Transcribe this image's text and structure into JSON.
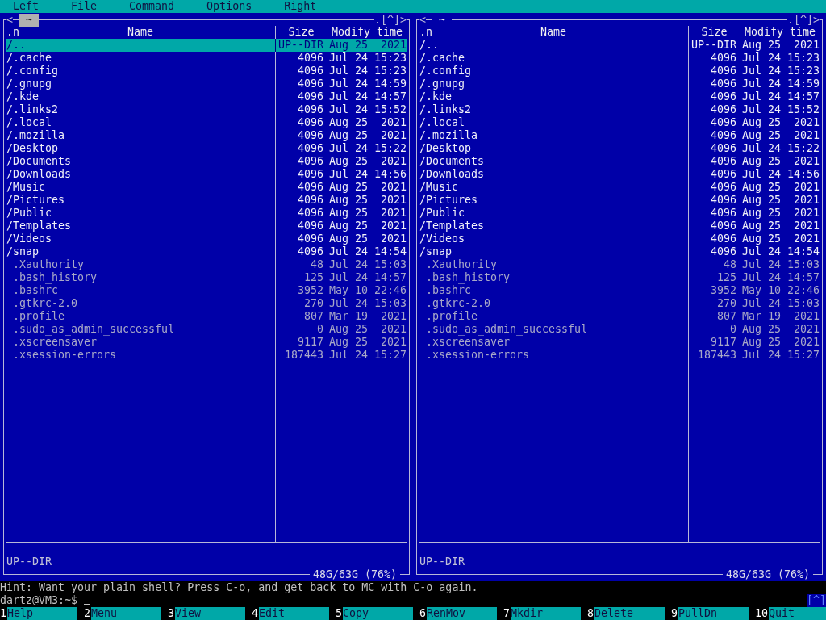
{
  "menu": [
    {
      "label": "Left"
    },
    {
      "label": "File"
    },
    {
      "label": "Command"
    },
    {
      "label": "Options"
    },
    {
      "label": "Right"
    }
  ],
  "panels": [
    {
      "active": true,
      "nav_left": "<",
      "path": "~",
      "nav_right": ".[^]>",
      "sort_mark": ".n",
      "columns": [
        "Name",
        "Size",
        "Modify time"
      ],
      "status": "UP--DIR",
      "disk": "48G/63G (76%)",
      "rows": [
        {
          "name": "/..",
          "size": "UP--DIR",
          "modified": "Aug 25  2021",
          "kind": "dir",
          "selected": true
        },
        {
          "name": "/.cache",
          "size": "4096",
          "modified": "Jul 24 15:23",
          "kind": "dir",
          "selected": false
        },
        {
          "name": "/.config",
          "size": "4096",
          "modified": "Jul 24 15:23",
          "kind": "dir",
          "selected": false
        },
        {
          "name": "/.gnupg",
          "size": "4096",
          "modified": "Jul 24 14:59",
          "kind": "dir",
          "selected": false
        },
        {
          "name": "/.kde",
          "size": "4096",
          "modified": "Jul 24 14:57",
          "kind": "dir",
          "selected": false
        },
        {
          "name": "/.links2",
          "size": "4096",
          "modified": "Jul 24 15:52",
          "kind": "dir",
          "selected": false
        },
        {
          "name": "/.local",
          "size": "4096",
          "modified": "Aug 25  2021",
          "kind": "dir",
          "selected": false
        },
        {
          "name": "/.mozilla",
          "size": "4096",
          "modified": "Aug 25  2021",
          "kind": "dir",
          "selected": false
        },
        {
          "name": "/Desktop",
          "size": "4096",
          "modified": "Jul 24 15:22",
          "kind": "dir",
          "selected": false
        },
        {
          "name": "/Documents",
          "size": "4096",
          "modified": "Aug 25  2021",
          "kind": "dir",
          "selected": false
        },
        {
          "name": "/Downloads",
          "size": "4096",
          "modified": "Jul 24 14:56",
          "kind": "dir",
          "selected": false
        },
        {
          "name": "/Music",
          "size": "4096",
          "modified": "Aug 25  2021",
          "kind": "dir",
          "selected": false
        },
        {
          "name": "/Pictures",
          "size": "4096",
          "modified": "Aug 25  2021",
          "kind": "dir",
          "selected": false
        },
        {
          "name": "/Public",
          "size": "4096",
          "modified": "Aug 25  2021",
          "kind": "dir",
          "selected": false
        },
        {
          "name": "/Templates",
          "size": "4096",
          "modified": "Aug 25  2021",
          "kind": "dir",
          "selected": false
        },
        {
          "name": "/Videos",
          "size": "4096",
          "modified": "Aug 25  2021",
          "kind": "dir",
          "selected": false
        },
        {
          "name": "/snap",
          "size": "4096",
          "modified": "Jul 24 14:54",
          "kind": "dir",
          "selected": false
        },
        {
          "name": ".Xauthority",
          "size": "48",
          "modified": "Jul 24 15:03",
          "kind": "file",
          "selected": false
        },
        {
          "name": ".bash_history",
          "size": "125",
          "modified": "Jul 24 14:57",
          "kind": "file",
          "selected": false
        },
        {
          "name": ".bashrc",
          "size": "3952",
          "modified": "May 10 22:46",
          "kind": "file",
          "selected": false
        },
        {
          "name": ".gtkrc-2.0",
          "size": "270",
          "modified": "Jul 24 15:03",
          "kind": "file",
          "selected": false
        },
        {
          "name": ".profile",
          "size": "807",
          "modified": "Mar 19  2021",
          "kind": "file",
          "selected": false
        },
        {
          "name": ".sudo_as_admin_successful",
          "size": "0",
          "modified": "Aug 25  2021",
          "kind": "file",
          "selected": false
        },
        {
          "name": ".xscreensaver",
          "size": "9117",
          "modified": "Aug 25  2021",
          "kind": "file",
          "selected": false
        },
        {
          "name": ".xsession-errors",
          "size": "187443",
          "modified": "Jul 24 15:27",
          "kind": "file",
          "selected": false
        }
      ]
    },
    {
      "active": false,
      "nav_left": "<",
      "path": "~",
      "nav_right": ".[^]>",
      "sort_mark": ".n",
      "columns": [
        "Name",
        "Size",
        "Modify time"
      ],
      "status": "UP--DIR",
      "disk": "48G/63G (76%)",
      "rows": [
        {
          "name": "/..",
          "size": "UP--DIR",
          "modified": "Aug 25  2021",
          "kind": "dir",
          "selected": false
        },
        {
          "name": "/.cache",
          "size": "4096",
          "modified": "Jul 24 15:23",
          "kind": "dir",
          "selected": false
        },
        {
          "name": "/.config",
          "size": "4096",
          "modified": "Jul 24 15:23",
          "kind": "dir",
          "selected": false
        },
        {
          "name": "/.gnupg",
          "size": "4096",
          "modified": "Jul 24 14:59",
          "kind": "dir",
          "selected": false
        },
        {
          "name": "/.kde",
          "size": "4096",
          "modified": "Jul 24 14:57",
          "kind": "dir",
          "selected": false
        },
        {
          "name": "/.links2",
          "size": "4096",
          "modified": "Jul 24 15:52",
          "kind": "dir",
          "selected": false
        },
        {
          "name": "/.local",
          "size": "4096",
          "modified": "Aug 25  2021",
          "kind": "dir",
          "selected": false
        },
        {
          "name": "/.mozilla",
          "size": "4096",
          "modified": "Aug 25  2021",
          "kind": "dir",
          "selected": false
        },
        {
          "name": "/Desktop",
          "size": "4096",
          "modified": "Jul 24 15:22",
          "kind": "dir",
          "selected": false
        },
        {
          "name": "/Documents",
          "size": "4096",
          "modified": "Aug 25  2021",
          "kind": "dir",
          "selected": false
        },
        {
          "name": "/Downloads",
          "size": "4096",
          "modified": "Jul 24 14:56",
          "kind": "dir",
          "selected": false
        },
        {
          "name": "/Music",
          "size": "4096",
          "modified": "Aug 25  2021",
          "kind": "dir",
          "selected": false
        },
        {
          "name": "/Pictures",
          "size": "4096",
          "modified": "Aug 25  2021",
          "kind": "dir",
          "selected": false
        },
        {
          "name": "/Public",
          "size": "4096",
          "modified": "Aug 25  2021",
          "kind": "dir",
          "selected": false
        },
        {
          "name": "/Templates",
          "size": "4096",
          "modified": "Aug 25  2021",
          "kind": "dir",
          "selected": false
        },
        {
          "name": "/Videos",
          "size": "4096",
          "modified": "Aug 25  2021",
          "kind": "dir",
          "selected": false
        },
        {
          "name": "/snap",
          "size": "4096",
          "modified": "Jul 24 14:54",
          "kind": "dir",
          "selected": false
        },
        {
          "name": ".Xauthority",
          "size": "48",
          "modified": "Jul 24 15:03",
          "kind": "file",
          "selected": false
        },
        {
          "name": ".bash_history",
          "size": "125",
          "modified": "Jul 24 14:57",
          "kind": "file",
          "selected": false
        },
        {
          "name": ".bashrc",
          "size": "3952",
          "modified": "May 10 22:46",
          "kind": "file",
          "selected": false
        },
        {
          "name": ".gtkrc-2.0",
          "size": "270",
          "modified": "Jul 24 15:03",
          "kind": "file",
          "selected": false
        },
        {
          "name": ".profile",
          "size": "807",
          "modified": "Mar 19  2021",
          "kind": "file",
          "selected": false
        },
        {
          "name": ".sudo_as_admin_successful",
          "size": "0",
          "modified": "Aug 25  2021",
          "kind": "file",
          "selected": false
        },
        {
          "name": ".xscreensaver",
          "size": "9117",
          "modified": "Aug 25  2021",
          "kind": "file",
          "selected": false
        },
        {
          "name": ".xsession-errors",
          "size": "187443",
          "modified": "Jul 24 15:27",
          "kind": "file",
          "selected": false
        }
      ]
    }
  ],
  "hint": "Hint: Want your plain shell? Press C-o, and get back to MC with C-o again.",
  "prompt": "dartz@VM3:~$",
  "corner": "[^]",
  "function_keys": [
    {
      "num": "1",
      "label": "Help"
    },
    {
      "num": "2",
      "label": "Menu"
    },
    {
      "num": "3",
      "label": "View"
    },
    {
      "num": "4",
      "label": "Edit"
    },
    {
      "num": "5",
      "label": "Copy"
    },
    {
      "num": "6",
      "label": "RenMov"
    },
    {
      "num": "7",
      "label": "Mkdir"
    },
    {
      "num": "8",
      "label": "Delete"
    },
    {
      "num": "9",
      "label": "PullDn"
    },
    {
      "num": "10",
      "label": "Quit"
    }
  ]
}
